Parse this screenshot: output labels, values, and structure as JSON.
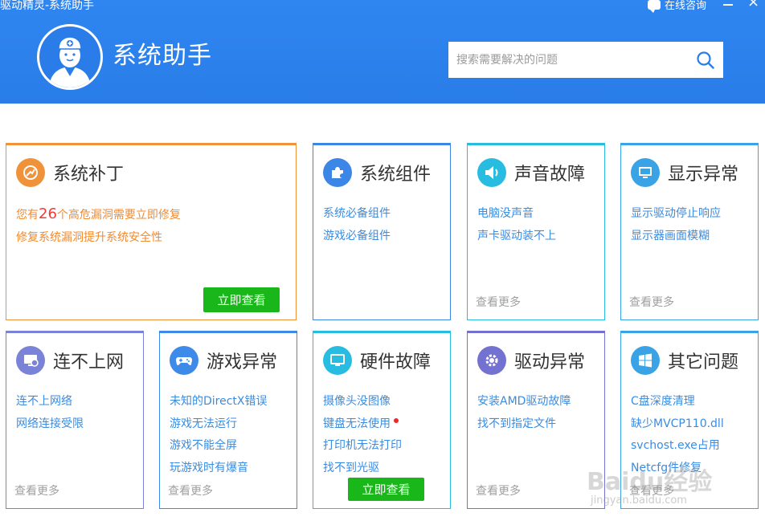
{
  "window": {
    "title": "驱动精灵-系统助手",
    "chat_label": "在线咨询",
    "minimize": "minimize",
    "close": "close"
  },
  "header": {
    "app_name": "系统助手",
    "search_placeholder": "搜索需要解决的问题"
  },
  "patch_card": {
    "title": "系统补丁",
    "line1_prefix": "您有",
    "count": "26",
    "line1_suffix": "个高危漏洞需要立即修复",
    "line2": "修复系统漏洞提升系统安全性",
    "button": "立即查看",
    "accent": "#f0923a"
  },
  "cards": [
    {
      "id": "components",
      "title": "系统组件",
      "links": [
        "系统必备组件",
        "游戏必备组件"
      ],
      "more": "",
      "icon": "puzzle-icon",
      "color": "#3c86e8"
    },
    {
      "id": "sound",
      "title": "声音故障",
      "links": [
        "电脑没声音",
        "声卡驱动装不上"
      ],
      "more": "查看更多",
      "icon": "speaker-icon",
      "color": "#28bde0"
    },
    {
      "id": "display",
      "title": "显示异常",
      "links": [
        "显示驱动停止响应",
        "显示器画面模糊"
      ],
      "more": "查看更多",
      "icon": "monitor-icon",
      "color": "#3aa3e6"
    },
    {
      "id": "network",
      "title": "连不上网",
      "links": [
        "连不上网络",
        "网络连接受限"
      ],
      "more": "查看更多",
      "icon": "network-monitor-icon",
      "color": "#7a83d8"
    },
    {
      "id": "game",
      "title": "游戏异常",
      "links": [
        "未知的DirectX错误",
        "游戏无法运行",
        "游戏不能全屏",
        "玩游戏时有爆音"
      ],
      "more": "查看更多",
      "icon": "gamepad-icon",
      "color": "#3d8ae8"
    },
    {
      "id": "hardware",
      "title": "硬件故障",
      "links": [
        "摄像头没图像",
        "键盘无法使用",
        "打印机无法打印",
        "找不到光驱"
      ],
      "more": "",
      "button": "立即查看",
      "icon": "screen-icon",
      "color": "#28bde0"
    },
    {
      "id": "driver",
      "title": "驱动异常",
      "links": [
        "安装AMD驱动故障",
        "找不到指定文件"
      ],
      "more": "查看更多",
      "icon": "gear-icon",
      "color": "#7472d0"
    },
    {
      "id": "other",
      "title": "其它问题",
      "links": [
        "C盘深度清理",
        "缺少MVCP110.dll",
        "svchost.exe占用",
        "Netcfg件修复"
      ],
      "more": "查看更多",
      "icon": "windows-icon",
      "color": "#3aa3e6"
    }
  ],
  "watermark": {
    "main": "Baidu经验",
    "sub": "jingyan.baidu.com"
  }
}
